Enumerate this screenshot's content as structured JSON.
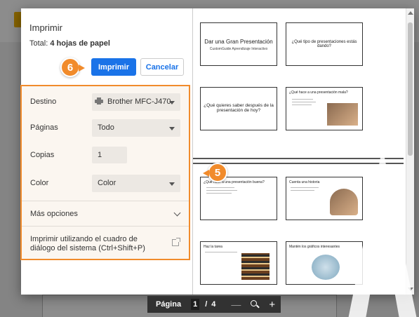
{
  "dialog": {
    "title": "Imprimir",
    "total_label": "Total:",
    "total_value": "4 hojas de papel",
    "print_button": "Imprimir",
    "cancel_button": "Cancelar"
  },
  "callouts": {
    "print_step": "6",
    "settings_step": "5",
    "color": "#f18b2b"
  },
  "settings": {
    "destination": {
      "label": "Destino",
      "value": "Brother MFC-J470",
      "icon": "printer-icon"
    },
    "pages": {
      "label": "Páginas",
      "value": "Todo"
    },
    "copies": {
      "label": "Copias",
      "value": "1"
    },
    "color": {
      "label": "Color",
      "value": "Color"
    },
    "more_options": "Más opciones",
    "system_dialog": "Imprimir utilizando el cuadro de diálogo del sistema (Ctrl+Shift+P)"
  },
  "preview": {
    "slides": [
      {
        "title": "Dar una Gran Presentación",
        "subtitle": "CustomGuide Aprendizaje Interactivo"
      },
      {
        "title": "¿Qué tipo de presentaciones estás dando?"
      },
      {
        "title": "¿Qué quieres saber después de la presentación de hoy?"
      },
      {
        "title": "¿Qué hace a una presentación mala?"
      },
      {
        "title": "¿Qué hace a una presentación buena?"
      },
      {
        "title": "Cuenta una historia"
      },
      {
        "title": "Haz la tarea"
      },
      {
        "title": "Mantén los gráficos interesantes"
      }
    ]
  },
  "pagebar": {
    "label": "Página",
    "current": "1",
    "separator": "/",
    "total": "4"
  },
  "colors": {
    "accent": "#1a73e8",
    "toolbar": "#323232"
  }
}
